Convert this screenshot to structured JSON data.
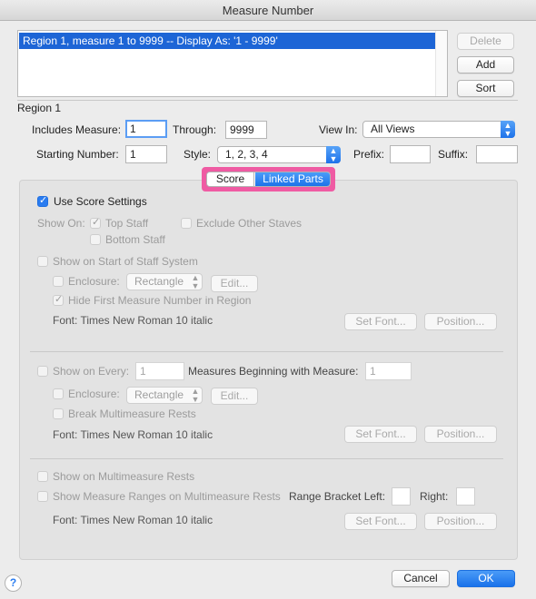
{
  "window": {
    "title": "Measure Number"
  },
  "regions_list": {
    "rows": [
      "Region   1, measure    1 to 9999 -- Display As: '1 - 9999'"
    ]
  },
  "side_buttons": {
    "delete": "Delete",
    "add": "Add",
    "sort": "Sort"
  },
  "region": {
    "label": "Region 1",
    "includes_measure_label": "Includes Measure:",
    "includes_measure_value": "1",
    "through_label": "Through:",
    "through_value": "9999",
    "view_in_label": "View In:",
    "view_in_value": "All Views",
    "starting_number_label": "Starting Number:",
    "starting_number_value": "1",
    "style_label": "Style:",
    "style_value": "1, 2, 3, 4",
    "prefix_label": "Prefix:",
    "prefix_value": "",
    "suffix_label": "Suffix:",
    "suffix_value": ""
  },
  "segments": {
    "score": "Score",
    "linked_parts": "Linked Parts",
    "selected": "Linked Parts",
    "highlight_color": "#ef5ba3"
  },
  "panel": {
    "use_score_settings": "Use Score Settings",
    "use_score_settings_checked": true,
    "show_on_label": "Show On:",
    "top_staff": "Top Staff",
    "exclude_other_staves": "Exclude Other Staves",
    "bottom_staff": "Bottom Staff",
    "sec1": {
      "show_on_start": "Show on Start of Staff System",
      "enclosure_label": "Enclosure:",
      "enclosure_value": "Rectangle",
      "edit": "Edit...",
      "hide_first": "Hide First Measure Number in Region",
      "font_text": "Font:   Times New Roman 10  italic",
      "set_font": "Set Font...",
      "position": "Position..."
    },
    "sec2": {
      "show_on_every": "Show on Every:",
      "every_value": "1",
      "beginning_label": "Measures Beginning with Measure:",
      "beginning_value": "1",
      "enclosure_label": "Enclosure:",
      "enclosure_value": "Rectangle",
      "edit": "Edit...",
      "break_multimeasure": "Break Multimeasure Rests",
      "font_text": "Font:   Times New Roman 10  italic",
      "set_font": "Set Font...",
      "position": "Position..."
    },
    "sec3": {
      "show_on_multimeasure": "Show on Multimeasure Rests",
      "show_ranges": "Show Measure Ranges on Multimeasure Rests",
      "range_left_label": "Range Bracket Left:",
      "range_right_label": "Right:",
      "font_text": "Font:   Times New Roman 10  italic",
      "set_font": "Set Font...",
      "position": "Position..."
    }
  },
  "footer": {
    "help": "?",
    "cancel": "Cancel",
    "ok": "OK"
  },
  "colors": {
    "accent": "#1d72ea",
    "selection": "#1d65d6"
  }
}
